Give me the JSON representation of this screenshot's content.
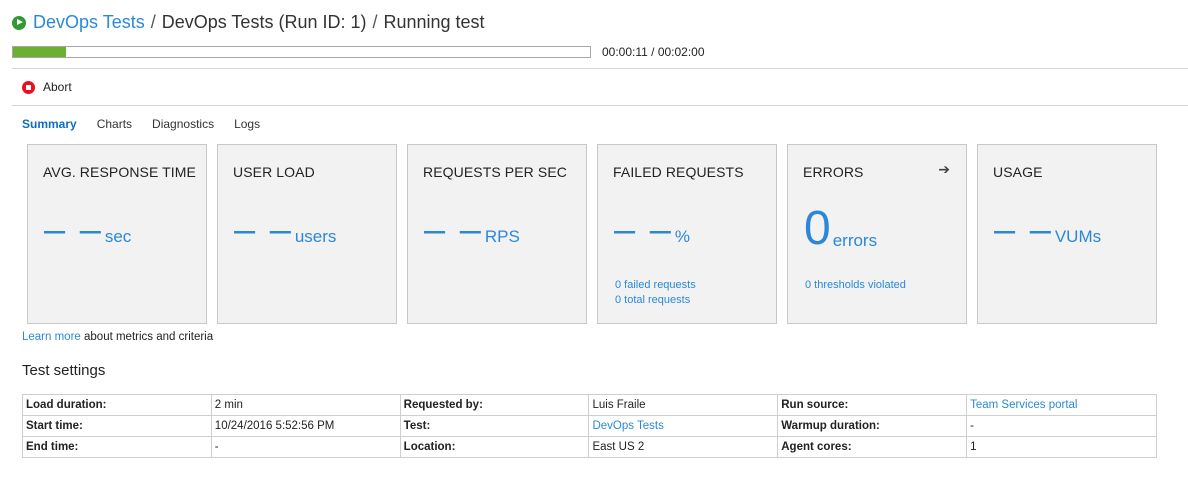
{
  "header": {
    "breadcrumb_root": "DevOps Tests",
    "separator": " / ",
    "breadcrumb_run": "DevOps Tests (Run ID: 1)",
    "breadcrumb_status": "Running test"
  },
  "progress": {
    "fraction": 0.0917,
    "elapsed_label": "00:00:11 / 00:02:00",
    "fill_color": "#6ab12f"
  },
  "toolbar": {
    "abort_label": "Abort"
  },
  "tabs": [
    {
      "label": "Summary",
      "active": true
    },
    {
      "label": "Charts",
      "active": false
    },
    {
      "label": "Diagnostics",
      "active": false
    },
    {
      "label": "Logs",
      "active": false
    }
  ],
  "metrics": {
    "avg_response_time": {
      "title": "AVG. RESPONSE TIME",
      "value": "– –",
      "unit": "sec"
    },
    "user_load": {
      "title": "USER LOAD",
      "value": "– –",
      "unit": "users"
    },
    "requests_per_sec": {
      "title": "REQUESTS PER SEC",
      "value": "– –",
      "unit": "RPS"
    },
    "failed_requests": {
      "title": "FAILED REQUESTS",
      "value": "– –",
      "unit": "%",
      "sub1": "0 failed requests",
      "sub2": "0 total requests"
    },
    "errors": {
      "title": "ERRORS",
      "value": "0",
      "unit": "errors",
      "sub1": "0 thresholds violated",
      "arrow_icon": "arrow-right-icon"
    },
    "usage": {
      "title": "USAGE",
      "value": "– –",
      "unit": "VUMs"
    }
  },
  "learn_more": {
    "link": "Learn more",
    "text": " about metrics and criteria"
  },
  "settings": {
    "title": "Test settings",
    "rows": [
      [
        {
          "label": "Load duration:",
          "value": "2 min"
        },
        {
          "label": "Requested by:",
          "value": "Luis Fraile"
        },
        {
          "label": "Run source:",
          "value": "Team Services portal",
          "link": true
        }
      ],
      [
        {
          "label": "Start time:",
          "value": "10/24/2016 5:52:56 PM"
        },
        {
          "label": "Test:",
          "value": "DevOps Tests",
          "link": true
        },
        {
          "label": "Warmup duration:",
          "value": "-"
        }
      ],
      [
        {
          "label": "End time:",
          "value": "-"
        },
        {
          "label": "Location:",
          "value": "East US 2"
        },
        {
          "label": "Agent cores:",
          "value": "1"
        }
      ]
    ]
  },
  "colors": {
    "accent": "#2b88d8",
    "tab_active": "#106ebe",
    "abort": "#e81123",
    "running": "#339933"
  }
}
